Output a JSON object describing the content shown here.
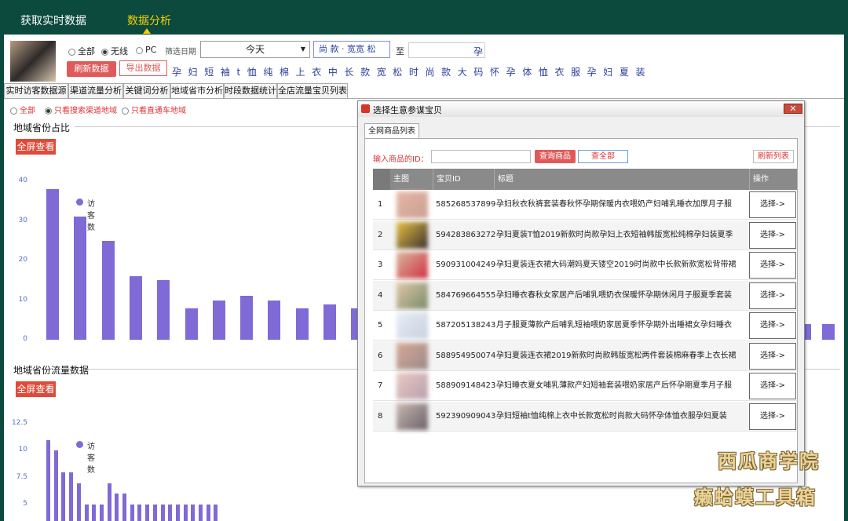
{
  "topnav": {
    "item1": "获取实时数据",
    "item2": "数据分析"
  },
  "filters": {
    "radio_all": "全部",
    "radio_wireless": "无线",
    "radio_pc": "PC",
    "date_label": "筛选日期",
    "date_value": "今天",
    "search_value": "尚 款 · 宽宽 松",
    "to_label": "至",
    "refresh_button": "刷新数据",
    "export_button": "导出数据",
    "keywords": "孕 妇 短 袖 t 恤 纯 棉 上 衣 中 长 款 宽 松 时 尚 款 大 码 怀 孕 体 恤 衣 服 孕 妇 夏 装"
  },
  "tabs": [
    "实时访客数据源",
    "渠道流量分析",
    "关键词分析",
    "地域省市分析",
    "时段数据统计",
    "全店流量宝贝列表"
  ],
  "subfilters": {
    "all": "全部",
    "search": "只看搜索渠道地域",
    "direct": "只看直通车地域"
  },
  "chart1": {
    "title": "地域省份占比",
    "fullscreen": "全屏查看"
  },
  "chart2": {
    "title": "地域省份流量数据",
    "fullscreen": "全屏查看"
  },
  "chart_data": [
    {
      "type": "bar",
      "title": "地域省份占比",
      "ylim": [
        0,
        40
      ],
      "yticks": [
        "40",
        "30",
        "20",
        "10",
        "0"
      ],
      "series": [
        {
          "name": "访客数",
          "values": [
            38,
            31,
            25,
            16,
            15,
            8,
            10,
            11,
            10,
            8,
            9,
            8
          ]
        }
      ],
      "trailing_values": [
        1,
        1
      ],
      "legend": "top-left"
    },
    {
      "type": "bar",
      "title": "地域省份流量数据",
      "ylim": [
        0,
        12.5
      ],
      "yticks": [
        "12.5",
        "10",
        "7.5",
        "5"
      ],
      "series": [
        {
          "name": "访客数",
          "values": [
            11,
            10,
            8,
            8,
            7,
            4,
            5,
            5,
            7,
            6,
            6,
            5,
            5,
            5,
            5,
            5,
            5,
            4,
            5,
            3,
            4,
            2,
            4
          ]
        }
      ],
      "legend": "top-left"
    }
  ],
  "dialog": {
    "title": "选择生意参谋宝贝",
    "tab": "全网商品列表",
    "id_label": "输入商品的ID：",
    "query_button": "查询商品",
    "all_button": "查全部",
    "refresh_button": "刷新列表",
    "columns": [
      "主图",
      "宝贝ID",
      "标题",
      "操作"
    ],
    "rows": [
      {
        "no": "1",
        "id": "585268537899",
        "title": "孕妇秋衣秋裤套装春秋怀孕期保暖内衣喂奶产妇哺乳睡衣加厚月子服",
        "action": "选择->",
        "c1": "#e6b7a8",
        "c2": "#c8a090"
      },
      {
        "no": "2",
        "id": "594283863272",
        "title": "孕妇夏装T恤2019新款时尚款孕妇上衣短袖韩版宽松纯棉孕妇装夏季",
        "action": "选择->",
        "c1": "#e8c040",
        "c2": "#3a3030"
      },
      {
        "no": "3",
        "id": "590931004249",
        "title": "孕妇夏装连衣裙大码潮妈夏天镂空2019时尚款中长款新款宽松背带裙",
        "action": "选择->",
        "c1": "#d8b8a0",
        "c2": "#d03040"
      },
      {
        "no": "4",
        "id": "584769664555",
        "title": "孕妇睡衣春秋女家居产后哺乳喂奶衣保暖怀孕期休闲月子服夏季套装",
        "action": "选择->",
        "c1": "#e0c8a8",
        "c2": "#7a8a6a"
      },
      {
        "no": "5",
        "id": "587205138243",
        "title": "月子服夏薄款产后哺乳短袖喂奶家居夏季怀孕期外出睡裙女孕妇睡衣",
        "action": "选择->",
        "c1": "#e8eef4",
        "c2": "#c8d0e0"
      },
      {
        "no": "6",
        "id": "588954950074",
        "title": "孕妇夏装连衣裙2019新款时尚款韩版宽松两件套装棉麻春季上衣长裙",
        "action": "选择->",
        "c1": "#d8a898",
        "c2": "#9a8a88"
      },
      {
        "no": "7",
        "id": "588909148423",
        "title": "孕妇睡衣夏女哺乳薄款产妇短袖套装喂奶家居产后怀孕期夏季月子服",
        "action": "选择->",
        "c1": "#e8c8c0",
        "c2": "#b8a0b0"
      },
      {
        "no": "8",
        "id": "592390909043",
        "title": "孕妇短袖t恤纯棉上衣中长款宽松时尚款大码怀孕体恤衣服孕妇夏装",
        "action": "选择->",
        "c1": "#c8b8b0",
        "c2": "#6a6068"
      }
    ]
  },
  "watermark": {
    "line1": "西瓜商学院",
    "line2": "癞蛤蟆工具箱"
  }
}
